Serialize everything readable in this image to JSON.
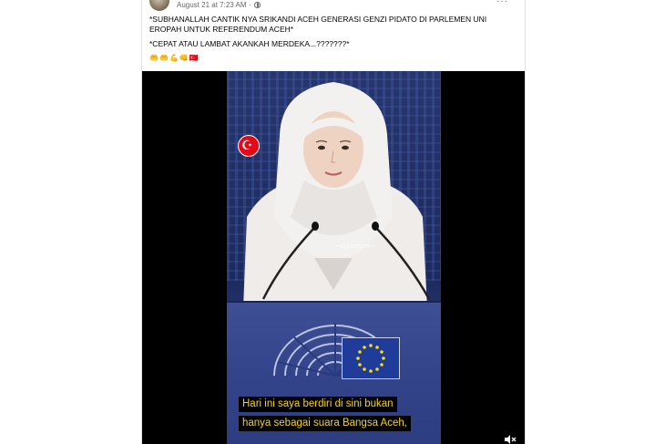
{
  "post": {
    "timestamp": "August 21 at 7:23 AM",
    "separator": "·",
    "audience_icon": "globe-icon",
    "more_icon": "more-horizontal-icon",
    "text_line_1": "*SUBHANALLAH CANTIK NYA  SRIKANDI ACEH GENERASI GENZI PIDATO DI PARLEMEN UNI EROPAH UNTUK REFERENDUM ACEH*",
    "text_line_2": "*CEPAT  ATAU LAMBAT AKANKAH  MERDEKA...???????*",
    "emojis": [
      "🤲",
      "🤲",
      "💪",
      "👊",
      "🇹🇷"
    ]
  },
  "video": {
    "watermark_icon": "turkey-flag-icon",
    "watermark_symbol": "☪",
    "subtitle_line_1": "Hari ini saya berdiri di sini bukan",
    "subtitle_line_2": "hanya sebagai suara Bangsa Aceh,"
  },
  "colors": {
    "subtitle_text": "#f4d31f",
    "eu_blue": "#1f3c9b",
    "eu_star": "#ffdd00",
    "headscarf": "#f2f0ee"
  }
}
